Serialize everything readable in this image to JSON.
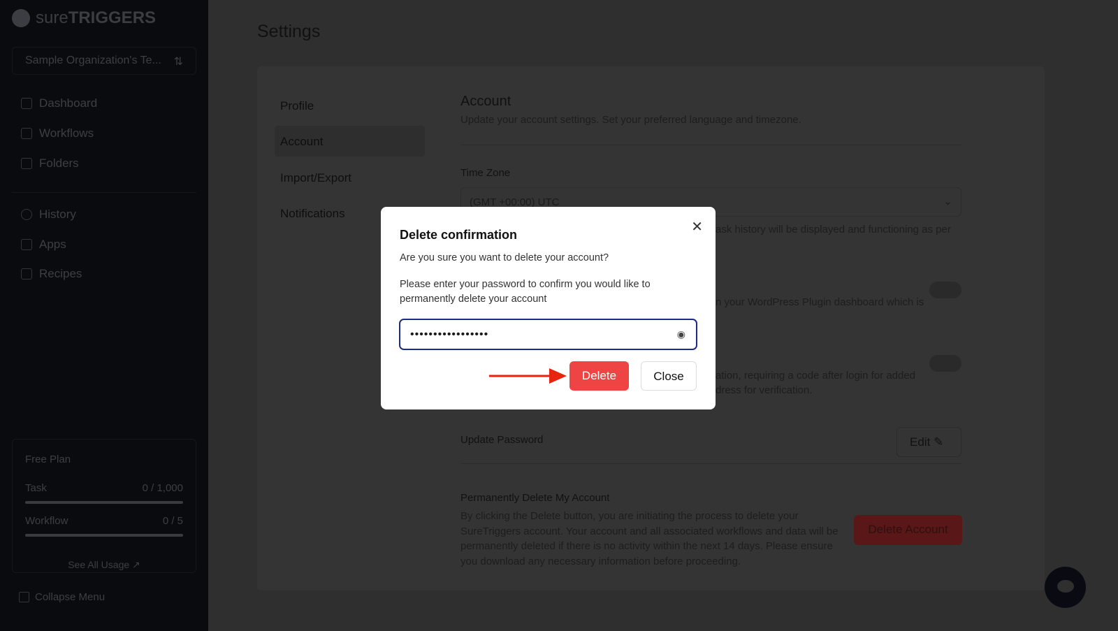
{
  "sidebar": {
    "brand_light": "sure",
    "brand_bold": "TRIGGERS",
    "org": "Sample Organization's Te...",
    "nav": [
      {
        "label": "Dashboard",
        "icon": "home-icon"
      },
      {
        "label": "Workflows",
        "icon": "workflow-icon"
      },
      {
        "label": "Folders",
        "icon": "folder-icon"
      },
      {
        "label": "History",
        "icon": "history-icon"
      },
      {
        "label": "Apps",
        "icon": "apps-icon"
      },
      {
        "label": "Recipes",
        "icon": "layers-icon"
      }
    ],
    "plan": {
      "name": "Free Plan",
      "task_label": "Task",
      "task_value": "0 / 1,000",
      "workflow_label": "Workflow",
      "workflow_value": "0 / 5",
      "see_all": "See All Usage ↗"
    },
    "collapse": "Collapse Menu"
  },
  "page": {
    "title": "Settings",
    "tabs": [
      "Profile",
      "Account",
      "Import/Export",
      "Notifications"
    ],
    "active_tab": "Account",
    "section_title": "Account",
    "section_desc": "Update your account settings. Set your preferred language and timezone.",
    "timezone_label": "Time Zone",
    "timezone_value": "(GMT +00:00) UTC",
    "timezone_help": "ask history will be displayed and functioning as per",
    "wp_help": "n your WordPress Plugin dashboard which is",
    "twofa_help1": "ation, requiring a code after login for added",
    "twofa_help2": "dress for verification.",
    "update_password": "Update Password",
    "edit": "Edit",
    "delete_title": "Permanently Delete My Account",
    "delete_desc": "By clicking the Delete button, you are initiating the process to delete your SureTriggers account. Your account and all associated workflows and data will be permanently deleted if there is no activity within the next 14 days. Please ensure you download any necessary information before proceeding.",
    "delete_account": "Delete Account"
  },
  "modal": {
    "title": "Delete confirmation",
    "question": "Are you sure you want to delete your account?",
    "instruction": "Please enter your password to confirm you would like to permanently delete your account",
    "password": "•••••••••••••••••",
    "delete": "Delete",
    "close": "Close"
  },
  "colors": {
    "danger": "#ef4444",
    "focus": "#1e2a8a"
  }
}
